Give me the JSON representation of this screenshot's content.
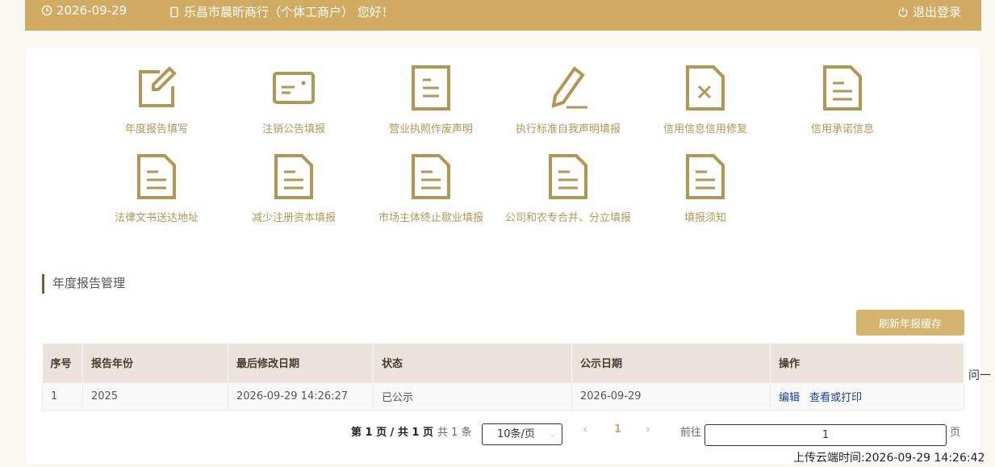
{
  "header": {
    "date": "2026-09-29",
    "greeting": "乐昌市晨昕商行（个体工商户） 您好！",
    "logout": "退出登录"
  },
  "menu": [
    {
      "label": "年度报告填写",
      "icon": "edit-icon"
    },
    {
      "label": "注销公告填报",
      "icon": "id-card-icon"
    },
    {
      "label": "营业执照作废声明",
      "icon": "document-icon"
    },
    {
      "label": "执行标准自我声明填报",
      "icon": "pencil-icon"
    },
    {
      "label": "信用信息信用修复",
      "icon": "document-x-icon"
    },
    {
      "label": "信用承诺信息",
      "icon": "document-icon"
    },
    {
      "label": "法律文书送达地址",
      "icon": "document-icon"
    },
    {
      "label": "减少注册资本填报",
      "icon": "document-icon"
    },
    {
      "label": "市场主体终止歇业填报",
      "icon": "document-icon"
    },
    {
      "label": "公司和农专合并、分立填报",
      "icon": "document-icon"
    },
    {
      "label": "填报须知",
      "icon": "document-icon"
    }
  ],
  "section": {
    "title": "年度报告管理",
    "refresh_button": "刷新年报缓存"
  },
  "table": {
    "headers": [
      "序号",
      "报告年份",
      "最后修改日期",
      "状态",
      "公示日期",
      "操作"
    ],
    "rows": [
      {
        "no": "1",
        "year": "2025",
        "modified": "2026-09-29 14:26:27",
        "status": "已公示",
        "public_date": "2026-09-29",
        "action_edit": "编辑",
        "action_print": "查看或打印"
      }
    ]
  },
  "pagination": {
    "page_info": "第 1 页 / 共 1 页",
    "total": "共 1 条",
    "page_size": "10条/页",
    "current_page": "1",
    "goto_label": "前往",
    "goto_value": "1",
    "page_suffix": "页"
  },
  "side_text": "问一",
  "upload_time": "上传云端时间:2026-09-29 14:26:42",
  "colors": {
    "accent": "#d1ab62",
    "icon": "#b39654"
  }
}
